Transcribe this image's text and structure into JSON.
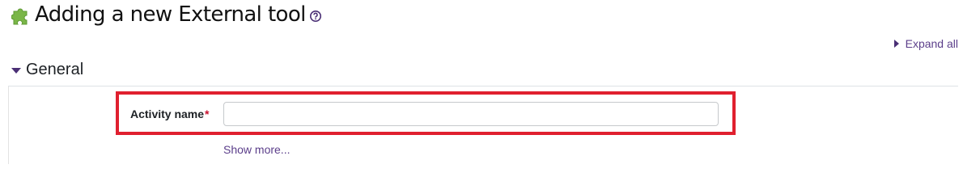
{
  "header": {
    "title": "Adding a new External tool",
    "title_icon": "puzzle-icon",
    "help_icon": "question-circle-icon"
  },
  "toolbar": {
    "expand_all_label": "Expand all",
    "expand_icon": "caret-right-icon"
  },
  "section": {
    "title": "General",
    "collapse_icon": "caret-down-icon"
  },
  "form": {
    "activity_name": {
      "label": "Activity name",
      "required_marker": "*",
      "value": "",
      "placeholder": ""
    },
    "show_more_label": "Show more..."
  },
  "colors": {
    "accent": "#5b3e8a",
    "highlight": "#e0202f",
    "required": "#c8102e",
    "puzzle_green": "#7ab648"
  }
}
